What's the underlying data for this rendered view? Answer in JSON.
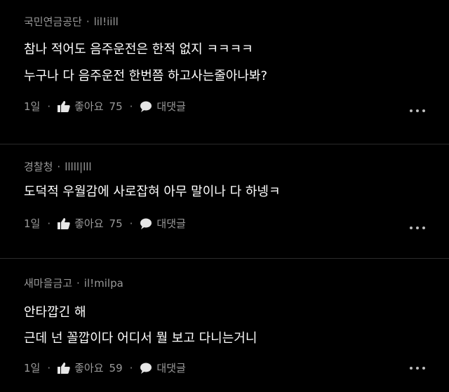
{
  "comments": [
    {
      "author": "국민연금공단",
      "handle": "lil!iill",
      "lines": [
        "참나 적어도 음주운전은 한적 없지 ㅋㅋㅋㅋ",
        "누구나 다 음주운전 한번쯤 하고사는줄아나봐?"
      ],
      "time": "1일",
      "like_label": "좋아요",
      "like_count": "75",
      "reply_label": "대댓글"
    },
    {
      "author": "경찰청",
      "handle": "lllll|lll",
      "lines": [
        "도덕적 우월감에 사로잡혀 아무 말이나 다 하넹ㅋ"
      ],
      "time": "1일",
      "like_label": "좋아요",
      "like_count": "75",
      "reply_label": "대댓글"
    },
    {
      "author": "새마을금고",
      "handle": "il!milpa",
      "lines": [
        "안타깝긴 해",
        "근데 넌 꼴깝이다 어디서 뭘 보고 다니는거니"
      ],
      "time": "1일",
      "like_label": "좋아요",
      "like_count": "59",
      "reply_label": "대댓글"
    }
  ],
  "separator": "·",
  "icons": {
    "like": "thumbs-up-icon",
    "reply": "speech-bubble-icon",
    "more": "more-options-icon"
  },
  "colors": {
    "background": "#000000",
    "text": "#ffffff",
    "meta": "#9a9a9a"
  }
}
